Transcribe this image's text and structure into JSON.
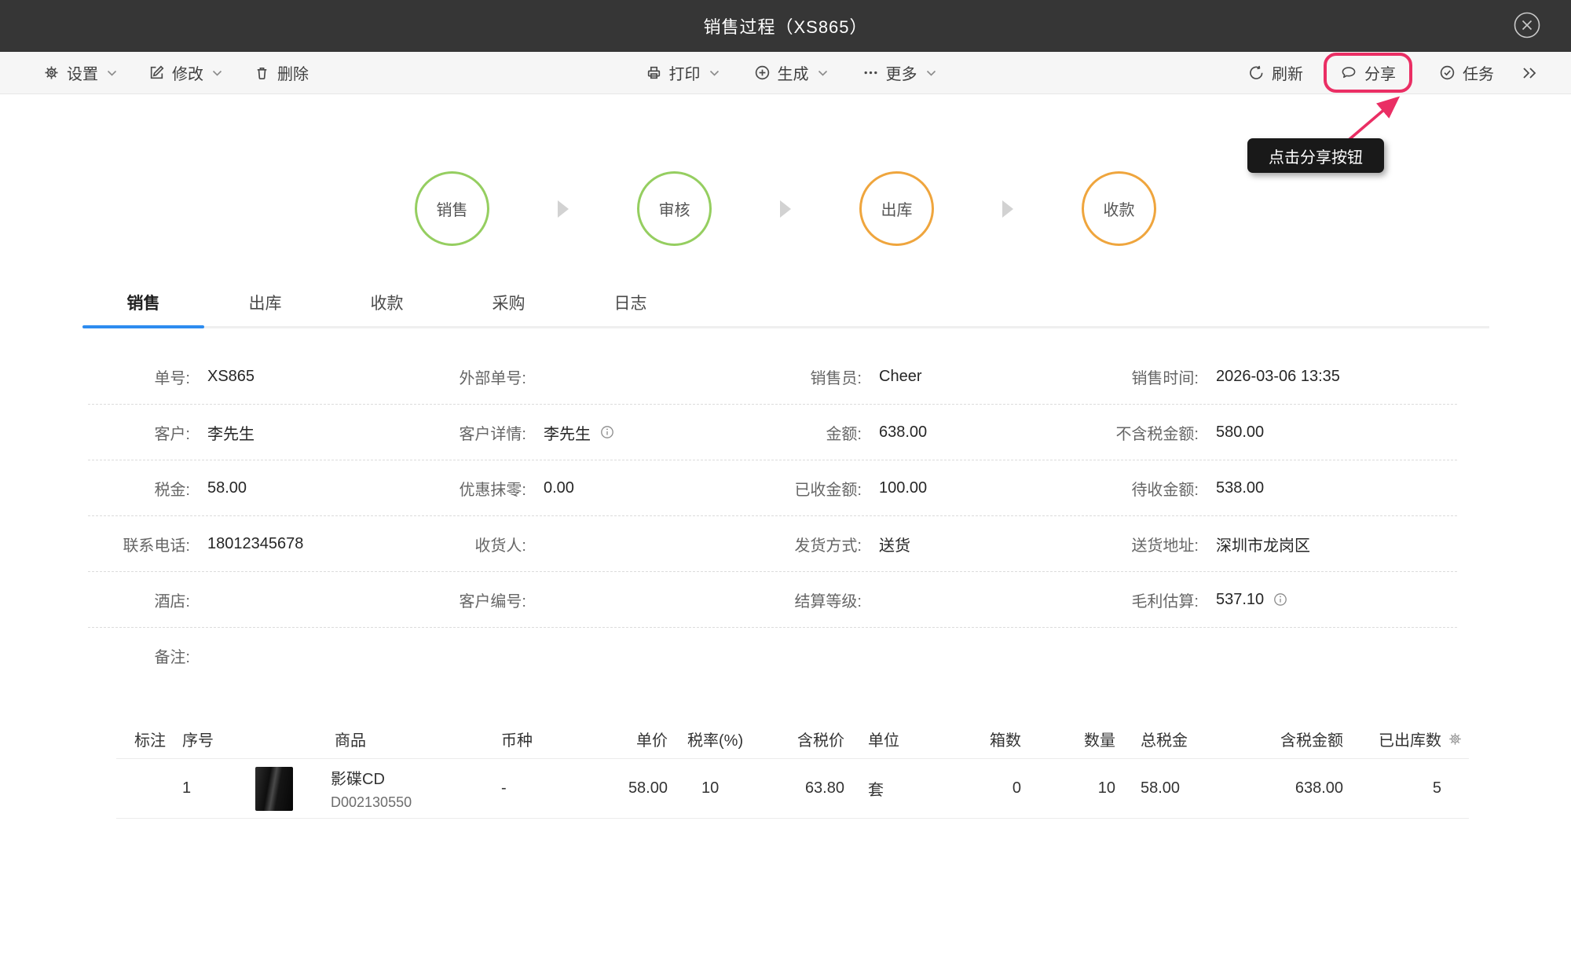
{
  "colors": {
    "titlebar_bg": "#363636",
    "accent_pink": "#ea2e64",
    "step_green": "#95ce60",
    "step_orange": "#efa53d",
    "tab_active_blue": "#2d8cf0"
  },
  "titlebar": {
    "title": "销售过程（XS865）"
  },
  "toolbar": {
    "settings": "设置",
    "modify": "修改",
    "delete": "删除",
    "print": "打印",
    "generate": "生成",
    "more": "更多",
    "refresh": "刷新",
    "share": "分享",
    "task": "任务"
  },
  "tooltip": {
    "text": "点击分享按钮"
  },
  "stepper": {
    "steps": [
      {
        "label": "销售",
        "color": "green"
      },
      {
        "label": "审核",
        "color": "green"
      },
      {
        "label": "出库",
        "color": "orange"
      },
      {
        "label": "收款",
        "color": "orange"
      }
    ]
  },
  "tabs": {
    "items": [
      {
        "label": "销售",
        "active": true
      },
      {
        "label": "出库",
        "active": false
      },
      {
        "label": "收款",
        "active": false
      },
      {
        "label": "采购",
        "active": false
      },
      {
        "label": "日志",
        "active": false
      }
    ]
  },
  "form": {
    "rows": [
      [
        {
          "label": "单号:",
          "value": "XS865"
        },
        {
          "label": "外部单号:",
          "value": ""
        },
        {
          "label": "销售员:",
          "value": "Cheer"
        },
        {
          "label": "销售时间:",
          "value": "2026-03-06 13:35"
        }
      ],
      [
        {
          "label": "客户:",
          "value": "李先生"
        },
        {
          "label": "客户详情:",
          "value": "李先生",
          "has_info": true
        },
        {
          "label": "金额:",
          "value": "638.00"
        },
        {
          "label": "不含税金额:",
          "value": "580.00"
        }
      ],
      [
        {
          "label": "税金:",
          "value": "58.00"
        },
        {
          "label": "优惠抹零:",
          "value": "0.00"
        },
        {
          "label": "已收金额:",
          "value": "100.00"
        },
        {
          "label": "待收金额:",
          "value": "538.00"
        }
      ],
      [
        {
          "label": "联系电话:",
          "value": "18012345678"
        },
        {
          "label": "收货人:",
          "value": ""
        },
        {
          "label": "发货方式:",
          "value": "送货"
        },
        {
          "label": "送货地址:",
          "value": "深圳市龙岗区"
        }
      ],
      [
        {
          "label": "酒店:",
          "value": ""
        },
        {
          "label": "客户编号:",
          "value": ""
        },
        {
          "label": "结算等级:",
          "value": ""
        },
        {
          "label": "毛利估算:",
          "value": "537.10",
          "has_info": true
        }
      ],
      [
        {
          "label": "备注:",
          "value": ""
        }
      ]
    ]
  },
  "table": {
    "headers": [
      "标注",
      "序号",
      "商品",
      "币种",
      "单价",
      "税率(%)",
      "含税价",
      "单位",
      "箱数",
      "数量",
      "总税金",
      "含税金额",
      "已出库数"
    ],
    "row": {
      "seq": "1",
      "name": "影碟CD",
      "code": "D002130550",
      "currency": "-",
      "unit_price": "58.00",
      "tax_rate": "10",
      "price_with_tax": "63.80",
      "unit": "套",
      "boxes": "0",
      "qty": "10",
      "total_tax": "58.00",
      "amount_with_tax": "638.00",
      "shipped_qty": "5"
    }
  }
}
